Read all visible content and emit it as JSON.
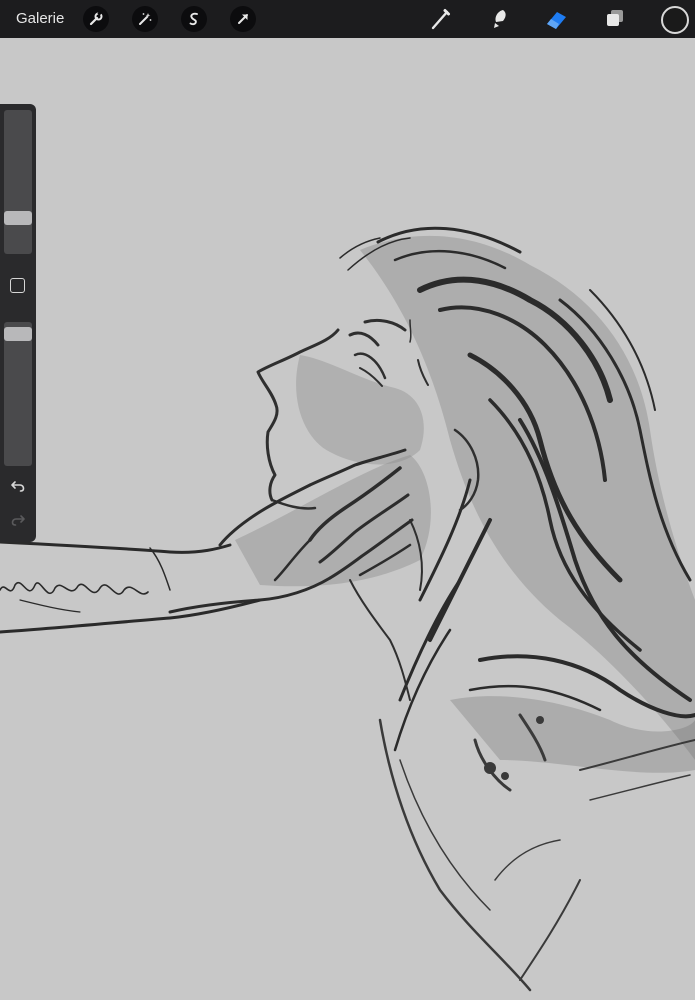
{
  "topbar": {
    "gallery_label": "Galerie",
    "actions": [
      {
        "name": "actions-wrench-icon"
      },
      {
        "name": "adjustments-wand-icon"
      },
      {
        "name": "selection-icon"
      },
      {
        "name": "transform-arrow-icon"
      }
    ],
    "tools": [
      {
        "name": "brush-icon",
        "active": false
      },
      {
        "name": "smudge-icon",
        "active": false
      },
      {
        "name": "eraser-icon",
        "active": true
      },
      {
        "name": "layers-icon",
        "active": false
      }
    ],
    "active_color": "#1a1a1a",
    "accent_color": "#1e7cf2"
  },
  "sidebar": {
    "brush_size_level": 0.22,
    "opacity_level": 0.96,
    "undo_icon": "undo-icon",
    "redo_icon": "redo-icon"
  },
  "canvas": {
    "background_color": "#c8c8c8",
    "subject": "sketch-of-face-held-by-hand"
  }
}
